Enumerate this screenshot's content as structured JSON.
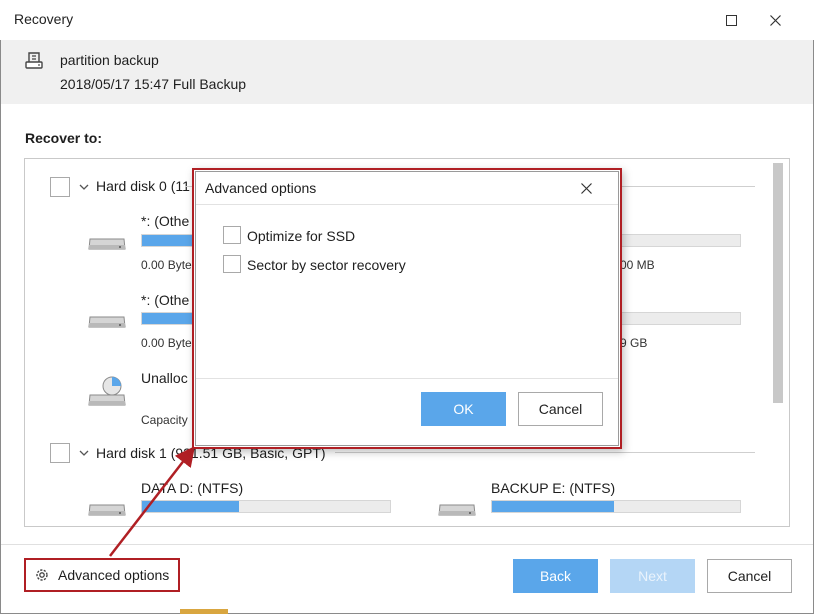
{
  "window": {
    "title": "Recovery"
  },
  "header": {
    "backup_name": "partition backup",
    "backup_info": "2018/05/17 15:47 Full Backup"
  },
  "recover_to_label": "Recover to:",
  "disks": [
    {
      "label": "Hard disk 0 (11",
      "partitions": [
        {
          "name": "*: (Othe",
          "size_left": "0.00 Byte",
          "size_right": "00 MB",
          "fill_fraction": 0.35
        },
        {
          "name": "*: (Othe",
          "size_left": "0.00 Byte",
          "size_right": "9 GB",
          "fill_fraction": 0.35
        },
        {
          "name": "Unalloc",
          "size_left": "Capacity",
          "size_right": ""
        }
      ]
    },
    {
      "label": "Hard disk 1 (931.51 GB, Basic, GPT)",
      "partitions": [
        {
          "name": "DATA D: (NTFS)",
          "fill_fraction": 0.39
        },
        {
          "name": "BACKUP E: (NTFS)",
          "fill_fraction": 0.49
        }
      ]
    }
  ],
  "dialog": {
    "title": "Advanced options",
    "options": [
      {
        "label": "Optimize for SSD",
        "checked": false
      },
      {
        "label": "Sector by sector recovery",
        "checked": false
      }
    ],
    "ok_label": "OK",
    "cancel_label": "Cancel"
  },
  "footer": {
    "advanced_options_label": "Advanced options",
    "back_label": "Back",
    "next_label": "Next",
    "cancel_label": "Cancel"
  },
  "colors": {
    "accent": "#5aa6ea",
    "accent_disabled": "#b4d6f5",
    "highlight_red": "#b01f24"
  },
  "icons": {
    "backup": "disk-backup-icon",
    "drive": "drive-icon",
    "unallocated": "unallocated-drive-icon",
    "gear": "gear-icon"
  }
}
